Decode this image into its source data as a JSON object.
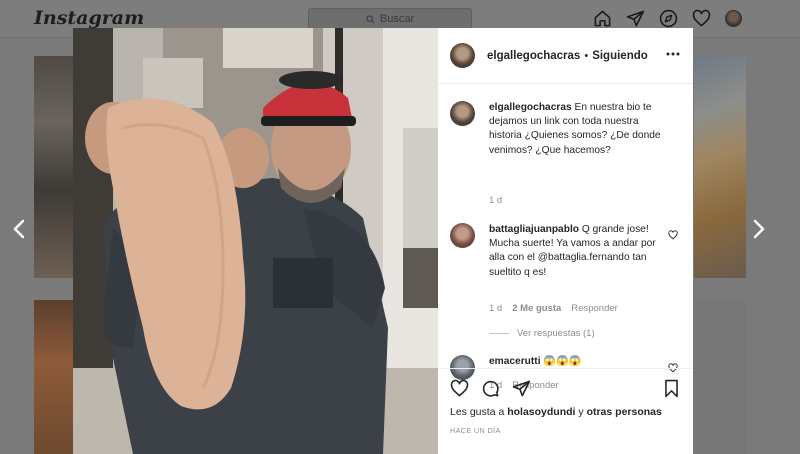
{
  "topbar": {
    "logo": "Instagram",
    "search_placeholder": "Buscar"
  },
  "post": {
    "author": "elgallegochacras",
    "separator": "•",
    "follow_status": "Siguiendo"
  },
  "comments": [
    {
      "user": "elgallegochacras",
      "text": "En nuestra bio te dejamos un link con toda nuestra historia ¿Quienes somos? ¿De donde venimos? ¿Que hacemos?",
      "time": "1 d"
    },
    {
      "user": "battagliajuanpablo",
      "text": "Q grande jose! Mucha suerte! Ya vamos a andar por alla con el @battaglia.fernando tan sueltito q es!",
      "time": "1 d",
      "likes": "2 Me gusta",
      "reply": "Responder",
      "view_replies": "Ver respuestas (1)"
    },
    {
      "user": "emacerutti",
      "text": "😱😱😱",
      "time": "1 d",
      "reply": "Responder"
    }
  ],
  "likes": {
    "prefix": "Les gusta a",
    "user": "holasoydundi",
    "middle": "y",
    "others": "otras personas"
  },
  "timestamp": "HACE UN DÍA",
  "icons": [
    "home-icon",
    "direct-icon",
    "explore-icon",
    "activity-heart-icon",
    "more-icon",
    "heart-icon",
    "comment-icon",
    "share-icon",
    "save-icon",
    "chevron-left-icon",
    "chevron-right-icon"
  ]
}
